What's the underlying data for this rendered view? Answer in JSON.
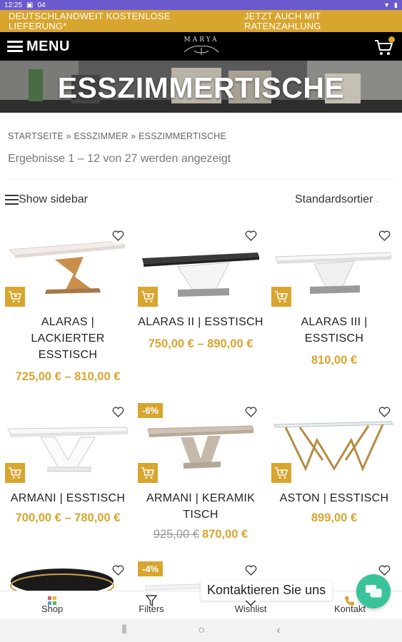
{
  "status_bar": {
    "time": "12:25",
    "notification_count": "04"
  },
  "promo": {
    "left": "DEUTSCHLANDWEIT KOSTENLOSE LIEFERUNG*",
    "right": "JETZT AUCH MIT RATENZAHLUNG"
  },
  "header": {
    "menu_label": "MENU",
    "logo_text": "MARYA"
  },
  "hero": {
    "title": "ESSZIMMERTISCHE"
  },
  "breadcrumb": {
    "items": [
      "STARTSEITE",
      "ESSZIMMER",
      "ESSZIMMERTISCHE"
    ],
    "separator": "»"
  },
  "result_count": "Ergebnisse 1 – 12 von 27 werden angezeigt",
  "toolbar": {
    "sidebar_label": "Show sidebar",
    "sort_label": "Standardsortier"
  },
  "products": [
    {
      "title": "ALARAS | LACKIERTER ESSTISCH",
      "price": "725,00 € – 810,00 €",
      "old_price": "",
      "badge": ""
    },
    {
      "title": "ALARAS II | ESSTISCH",
      "price": "750,00 € – 890,00 €",
      "old_price": "",
      "badge": ""
    },
    {
      "title": "ALARAS III | ESSTISCH",
      "price": "810,00 €",
      "old_price": "",
      "badge": ""
    },
    {
      "title": "ARMANI | ESSTISCH",
      "price": "700,00 € – 780,00 €",
      "old_price": "",
      "badge": ""
    },
    {
      "title": "ARMANI | KERAMIK TISCH",
      "price": "870,00 €",
      "old_price": "925,00 €",
      "badge": "-6%"
    },
    {
      "title": "ASTON | ESSTISCH",
      "price": "899,00 €",
      "old_price": "",
      "badge": ""
    },
    {
      "title": "",
      "price": "",
      "old_price": "",
      "badge": ""
    },
    {
      "title": "",
      "price": "",
      "old_price": "",
      "badge": "-4%"
    }
  ],
  "chat": {
    "label": "Kontaktieren Sie uns"
  },
  "bottom_nav": {
    "shop": "Shop",
    "filters": "Filters",
    "wishlist": "Wishlist",
    "kontakt": "Kontakt"
  },
  "colors": {
    "accent": "#d8a52f",
    "header_bg": "#000000",
    "status_bar": "#6a5acd",
    "chat": "#3ac39a"
  }
}
